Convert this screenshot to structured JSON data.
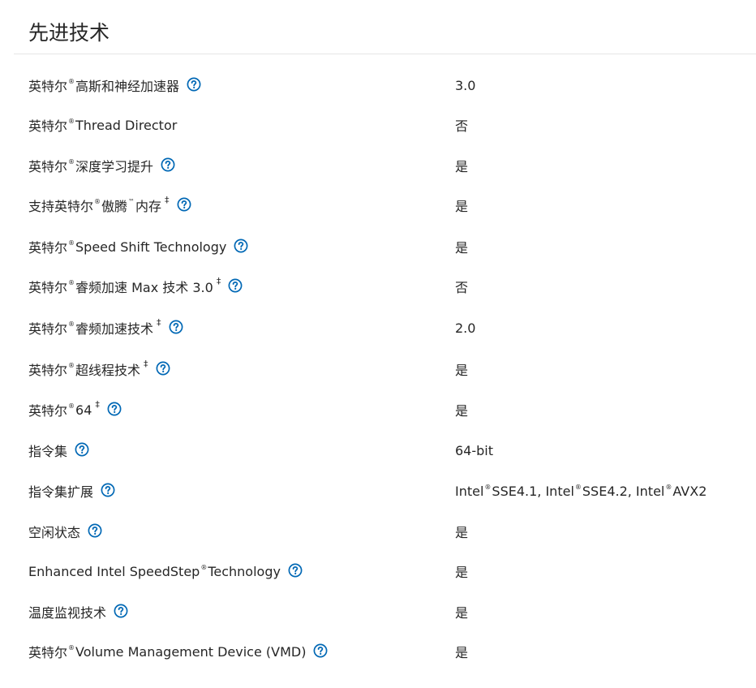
{
  "section": {
    "title": "先进技术"
  },
  "reg_mark": "®",
  "tm_mark": "™",
  "dagger": "‡",
  "colors": {
    "icon": "#0068b5",
    "text": "#262626",
    "divider": "#e6e6e6"
  },
  "icon_name": "help-circle-icon",
  "rows": [
    {
      "label_pre": "英特尔",
      "label_post": " 高斯和神经加速器",
      "value": "3.0"
    },
    {
      "label_pre": "英特尔",
      "label_post": " Thread Director",
      "value": "否"
    },
    {
      "label_pre": "英特尔",
      "label_post": " 深度学习提升",
      "value": "是"
    },
    {
      "label_pre": "支持英特尔",
      "label_mid": " 傲腾",
      "label_post": " 内存",
      "value": "是"
    },
    {
      "label_pre": "英特尔",
      "label_post": " Speed Shift Technology",
      "value": "是"
    },
    {
      "label_pre": "英特尔",
      "label_post": " 睿频加速 Max 技术 3.0",
      "value": "否"
    },
    {
      "label_pre": "英特尔",
      "label_post": " 睿频加速技术",
      "value": "2.0"
    },
    {
      "label_pre": "英特尔",
      "label_post": " 超线程技术",
      "value": "是"
    },
    {
      "label_pre": "英特尔",
      "label_post": " 64",
      "value": "是"
    },
    {
      "label_pre": "指令集",
      "value": "64-bit"
    },
    {
      "label_pre": "指令集扩展",
      "value_parts": [
        "Intel",
        "®",
        " SSE4.1, Intel",
        "®",
        " SSE4.2, Intel",
        "®",
        " AVX2"
      ]
    },
    {
      "label_pre": "空闲状态",
      "value": "是"
    },
    {
      "label_pre": "Enhanced Intel SpeedStep",
      "label_post": " Technology",
      "value": "是"
    },
    {
      "label_pre": "温度监视技术",
      "value": "是"
    },
    {
      "label_pre": "英特尔",
      "label_post": " Volume Management Device (VMD)",
      "value": "是"
    }
  ]
}
